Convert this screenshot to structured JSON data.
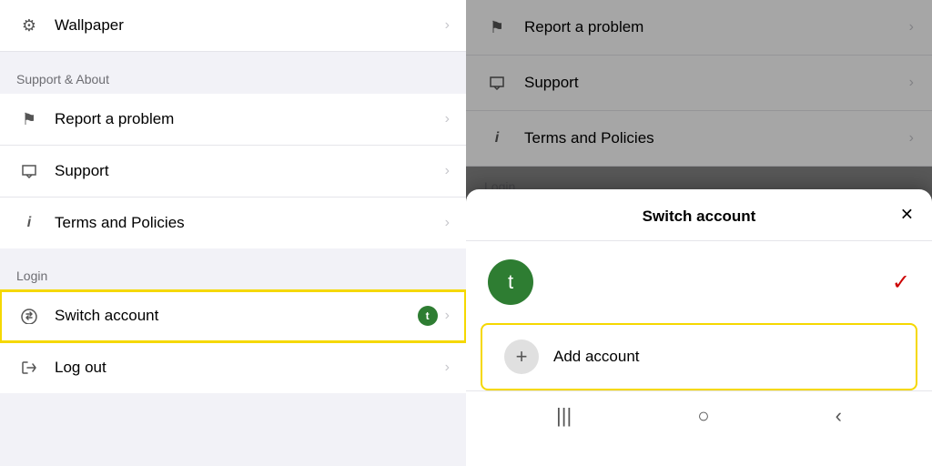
{
  "leftPanel": {
    "wallpaper": {
      "label": "Wallpaper",
      "icon": "⚙"
    },
    "supportSection": {
      "header": "Support & About",
      "items": [
        {
          "id": "report",
          "label": "Report a problem",
          "icon": "⚑"
        },
        {
          "id": "support",
          "label": "Support",
          "icon": "💬"
        },
        {
          "id": "terms",
          "label": "Terms and Policies",
          "icon": "ⓘ"
        }
      ]
    },
    "loginSection": {
      "header": "Login",
      "items": [
        {
          "id": "switch",
          "label": "Switch account",
          "icon": "⇄",
          "badge": "t",
          "highlighted": true
        },
        {
          "id": "logout",
          "label": "Log out",
          "icon": "⇤"
        }
      ]
    }
  },
  "rightPanel": {
    "topItems": [
      {
        "id": "report",
        "label": "Report a problem",
        "icon": "⚑"
      },
      {
        "id": "support",
        "label": "Support",
        "icon": "💬"
      },
      {
        "id": "terms",
        "label": "Terms and Policies",
        "icon": "ⓘ"
      }
    ],
    "loginHeader": "Login"
  },
  "modal": {
    "title": "Switch account",
    "closeIcon": "✕",
    "account": {
      "initial": "t",
      "checkIcon": "✓"
    },
    "addAccount": {
      "icon": "+",
      "label": "Add account"
    },
    "bottomNav": {
      "items": [
        "|||",
        "○",
        "<"
      ]
    }
  }
}
